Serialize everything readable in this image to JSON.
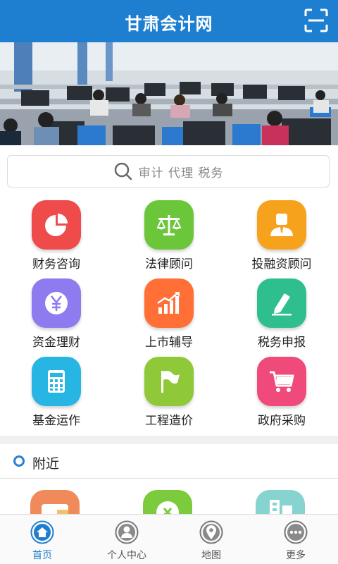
{
  "header": {
    "title": "甘肃会计网",
    "scan_icon": "scan-icon"
  },
  "banner": {
    "image": "classroom-computer-lab-photo"
  },
  "search": {
    "placeholder": "审计  代理  税务",
    "icon": "search-icon"
  },
  "services": [
    {
      "label": "财务咨询",
      "icon": "pie-chart-icon",
      "color": "#ef4b4b"
    },
    {
      "label": "法律顾问",
      "icon": "scales-icon",
      "color": "#6cc63a"
    },
    {
      "label": "投融资顾问",
      "icon": "person-icon",
      "color": "#f7a21c"
    },
    {
      "label": "资金理财",
      "icon": "yen-icon",
      "color": "#8e7bf0"
    },
    {
      "label": "上市辅导",
      "icon": "bar-chart-up-icon",
      "color": "#ff6f36"
    },
    {
      "label": "税务申报",
      "icon": "pen-icon",
      "color": "#2fbf8f"
    },
    {
      "label": "基金运作",
      "icon": "calculator-icon",
      "color": "#27b6e3"
    },
    {
      "label": "工程造价",
      "icon": "flag-icon",
      "color": "#8fc93a"
    },
    {
      "label": "政府采购",
      "icon": "cart-icon",
      "color": "#f04a7b"
    }
  ],
  "nearby": {
    "title": "附近",
    "tiles": [
      {
        "icon": "wallet-icon",
        "color": "#f08a5a"
      },
      {
        "icon": "coupon-icon",
        "color": "#7ccb3c"
      },
      {
        "icon": "building-icon",
        "color": "#86d3cf"
      }
    ]
  },
  "tabbar": {
    "items": [
      {
        "label": "首页",
        "icon": "home-icon",
        "active": true
      },
      {
        "label": "个人中心",
        "icon": "user-icon",
        "active": false
      },
      {
        "label": "地图",
        "icon": "map-pin-icon",
        "active": false
      },
      {
        "label": "更多",
        "icon": "more-icon",
        "active": false
      }
    ],
    "active_color": "#1e7fd0"
  },
  "colors": {
    "primary": "#1e7fd0"
  }
}
